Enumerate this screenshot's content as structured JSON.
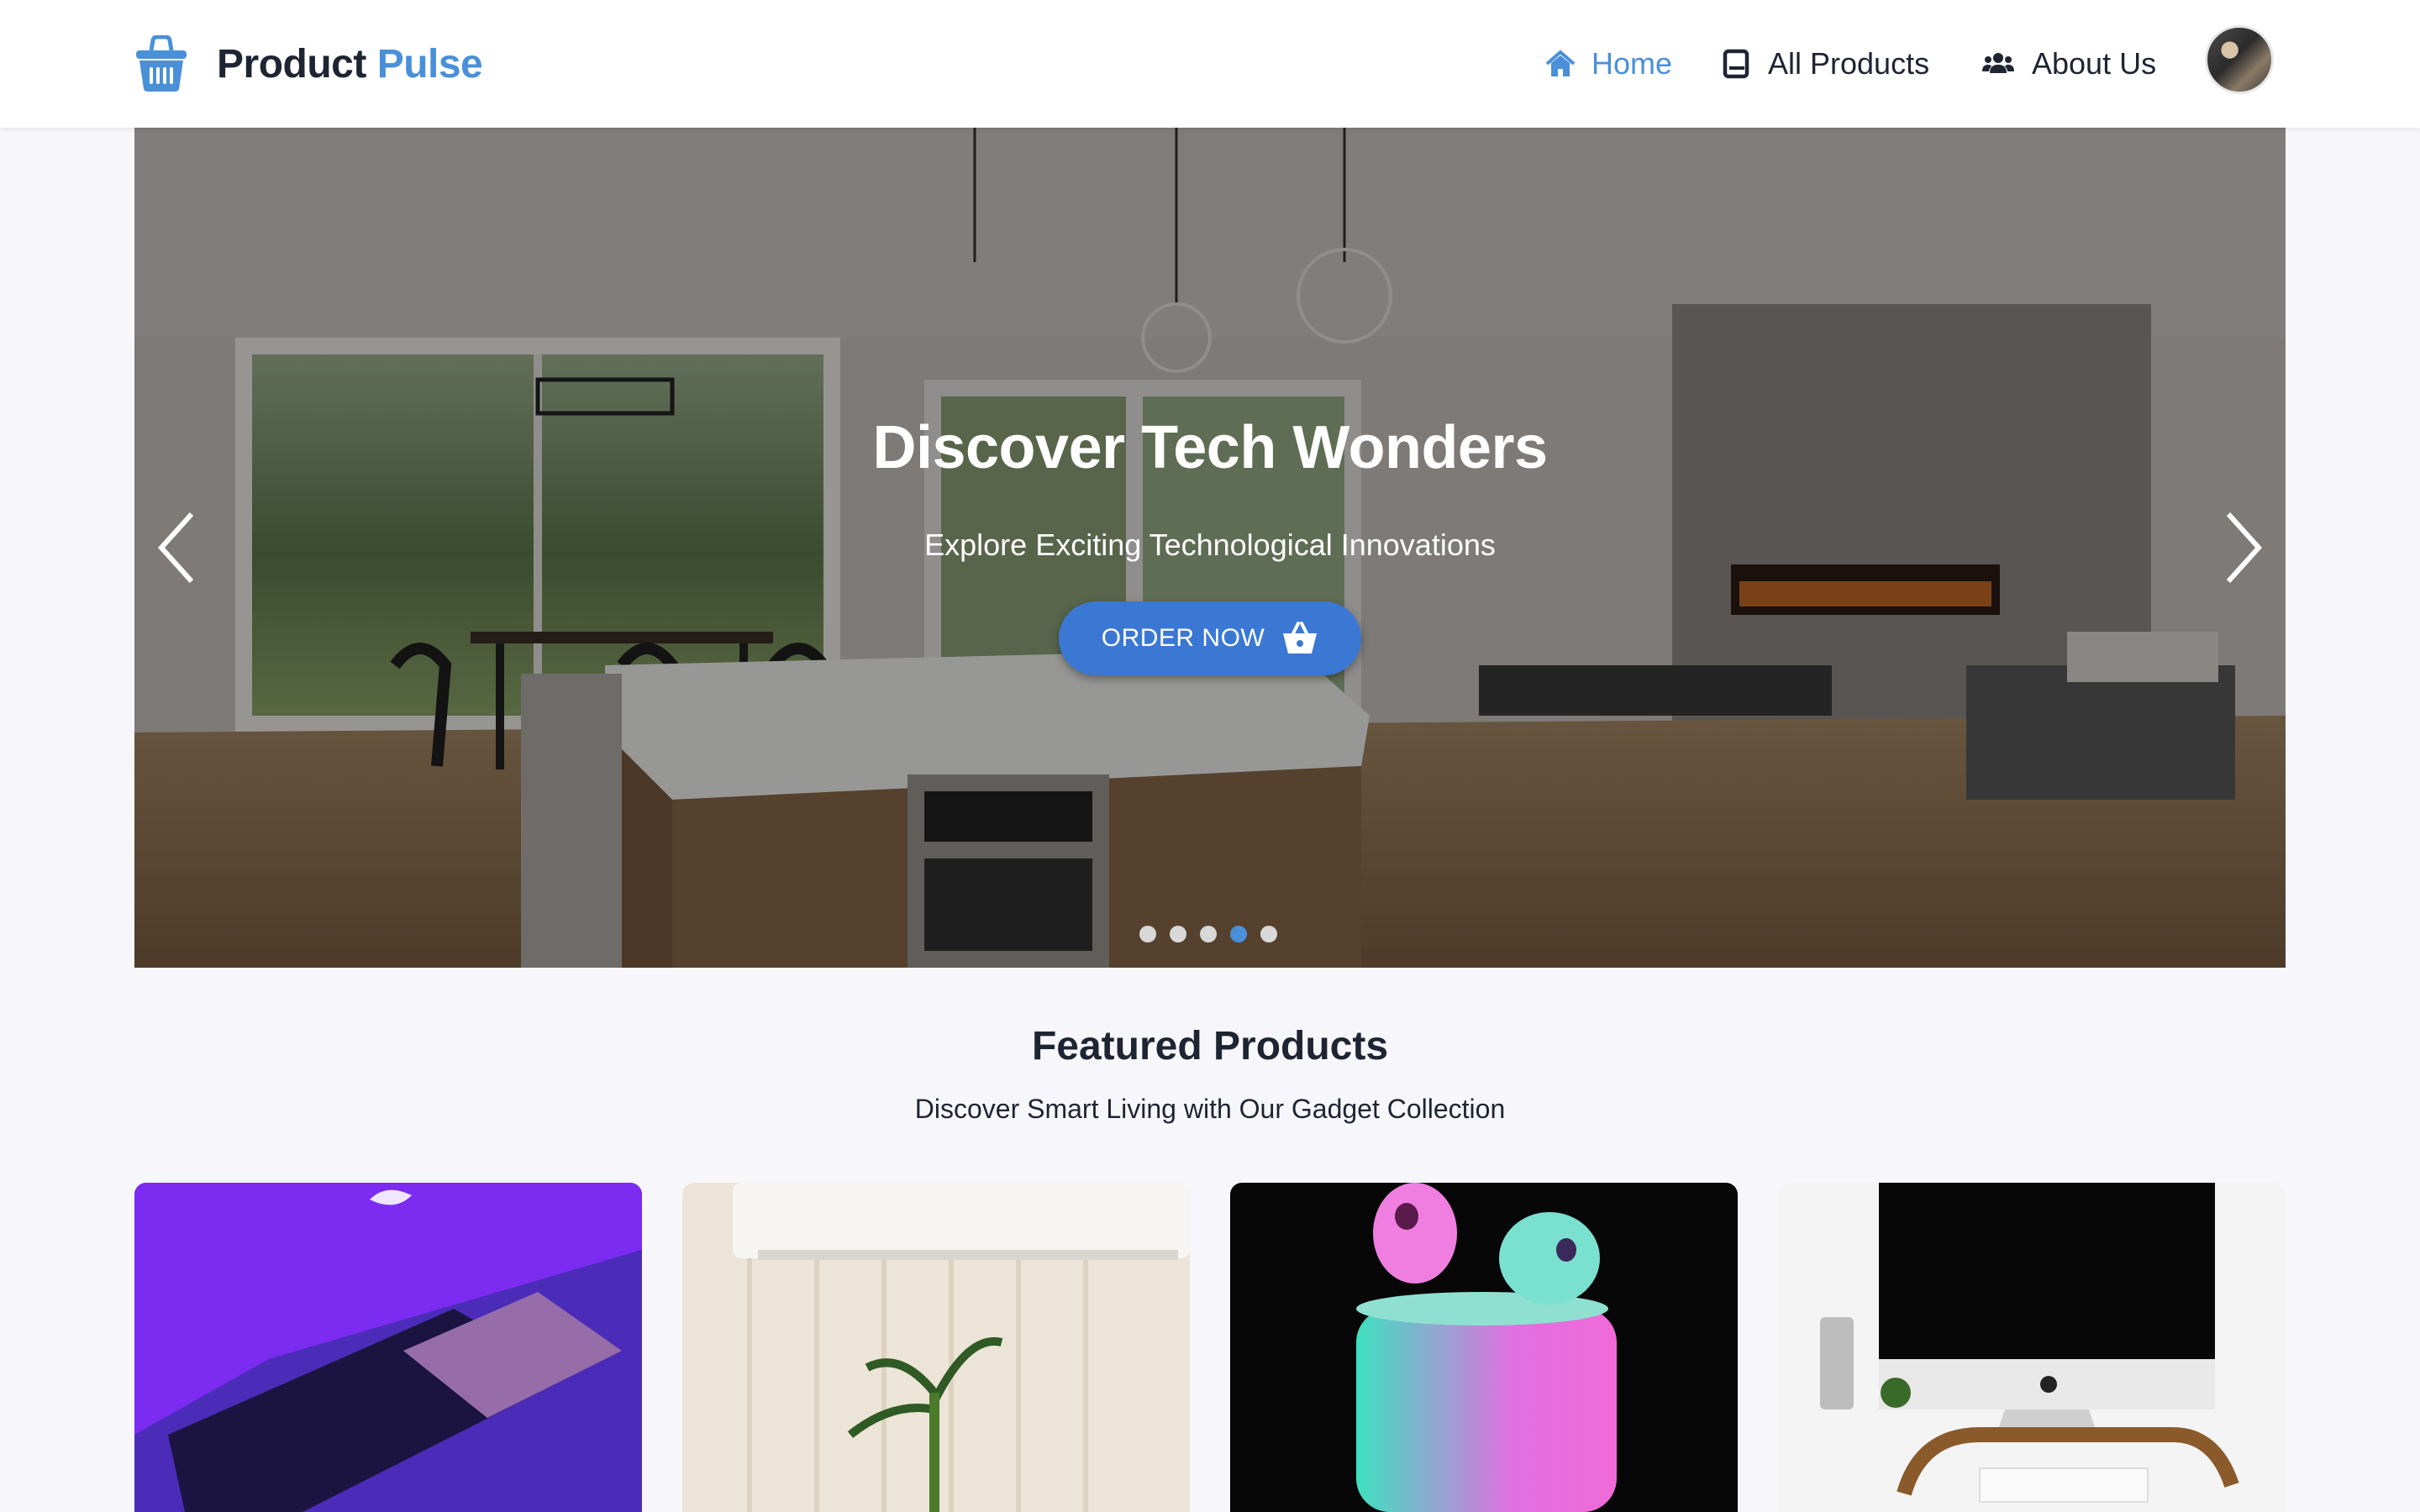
{
  "brand": {
    "name_part1": "Product",
    "name_part2": "Pulse",
    "icon": "basket-icon"
  },
  "nav": {
    "items": [
      {
        "label": "Home",
        "icon": "home-icon",
        "active": true
      },
      {
        "label": "All Products",
        "icon": "tablet-icon",
        "active": false
      },
      {
        "label": "About Us",
        "icon": "users-icon",
        "active": false
      }
    ],
    "avatar": "user-avatar"
  },
  "hero": {
    "title": "Discover Tech Wonders",
    "subtitle": "Explore Exciting Technological Innovations",
    "cta_label": "ORDER NOW",
    "slide_count": 5,
    "active_slide_index": 3
  },
  "featured": {
    "title": "Featured Products",
    "subtitle": "Discover Smart Living with Our Gadget Collection",
    "products": [
      {
        "image": "laptop-photo"
      },
      {
        "image": "air-conditioner-photo"
      },
      {
        "image": "earbuds-photo"
      },
      {
        "image": "desktop-monitor-photo"
      }
    ]
  },
  "colors": {
    "accent": "#4a90d9",
    "button": "#3a78d4",
    "background": "#f7f7fb",
    "text": "#1f2433"
  }
}
